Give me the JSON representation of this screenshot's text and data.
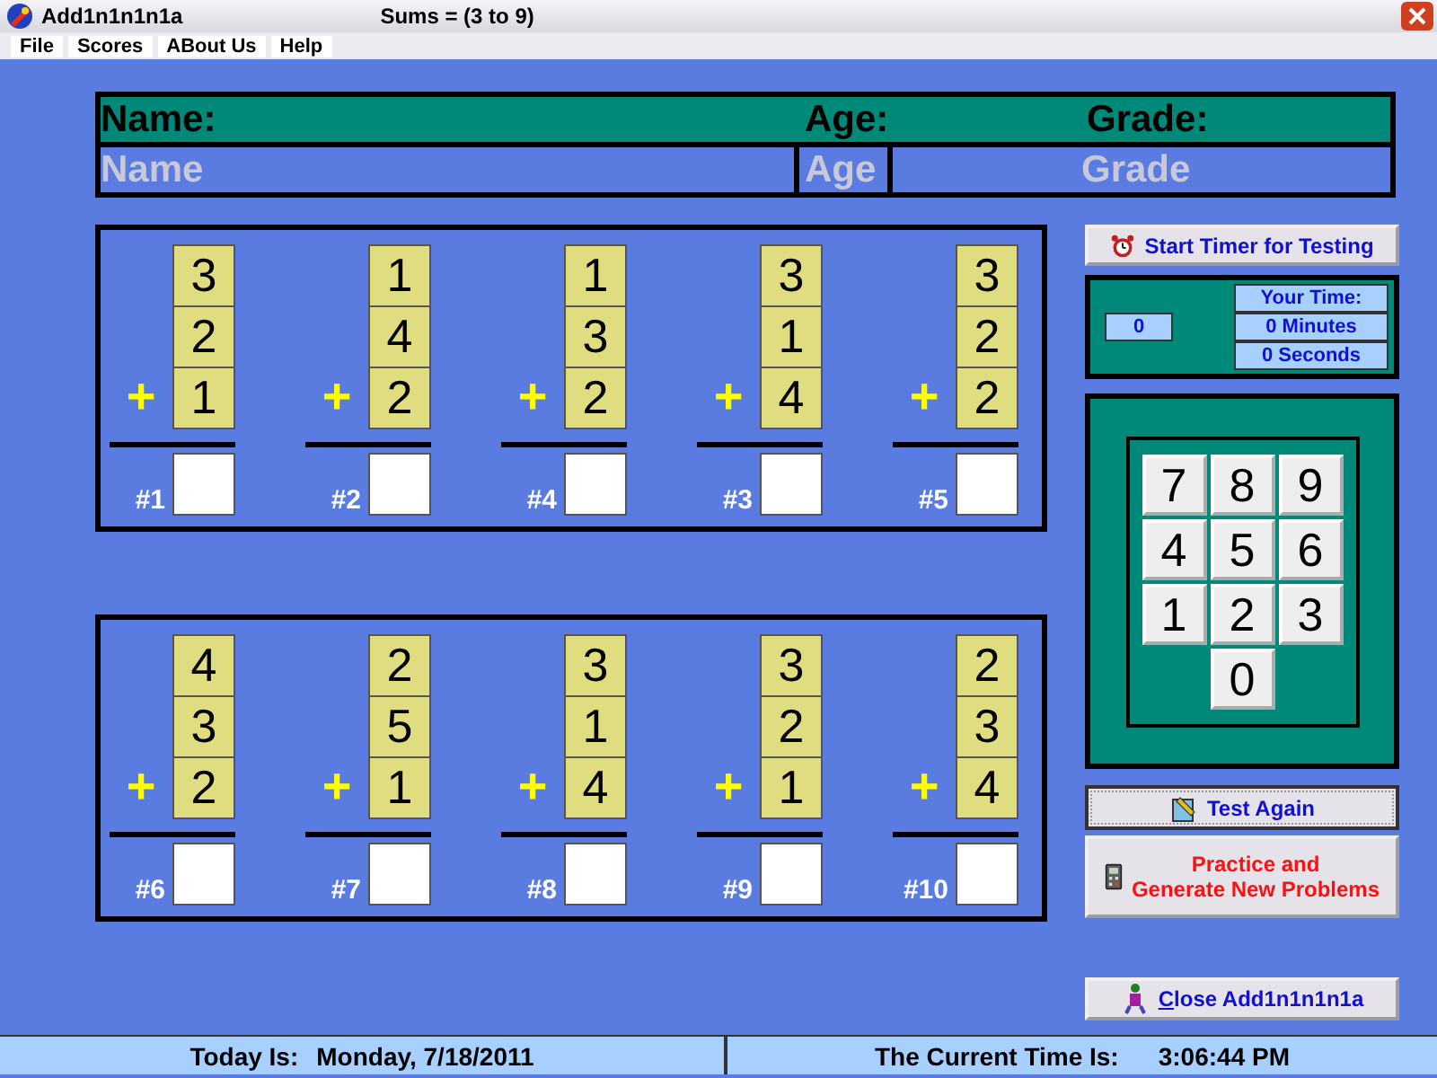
{
  "window": {
    "title": "Add1n1n1n1a",
    "subtitle": "Sums = (3 to 9)"
  },
  "menu": [
    "File",
    "Scores",
    "ABout Us",
    "Help"
  ],
  "student": {
    "labels": [
      "Name:",
      "Age:",
      "Grade:"
    ],
    "fields": [
      {
        "placeholder": "Name"
      },
      {
        "placeholder": "Age"
      },
      {
        "placeholder": "Grade"
      }
    ]
  },
  "problem_sets": [
    [
      {
        "label": "#1",
        "sign": "+",
        "addends": [
          "3",
          "2",
          "1"
        ]
      },
      {
        "label": "#2",
        "sign": "+",
        "addends": [
          "1",
          "4",
          "2"
        ]
      },
      {
        "label": "#4",
        "sign": "+",
        "addends": [
          "1",
          "3",
          "2"
        ]
      },
      {
        "label": "#3",
        "sign": "+",
        "addends": [
          "3",
          "1",
          "4"
        ]
      },
      {
        "label": "#5",
        "sign": "+",
        "addends": [
          "3",
          "2",
          "2"
        ]
      }
    ],
    [
      {
        "label": "#6",
        "sign": "+",
        "addends": [
          "4",
          "3",
          "2"
        ]
      },
      {
        "label": "#7",
        "sign": "+",
        "addends": [
          "2",
          "5",
          "1"
        ]
      },
      {
        "label": "#8",
        "sign": "+",
        "addends": [
          "3",
          "1",
          "4"
        ]
      },
      {
        "label": "#9",
        "sign": "+",
        "addends": [
          "3",
          "2",
          "1"
        ]
      },
      {
        "label": "#10",
        "sign": "+",
        "addends": [
          "2",
          "3",
          "4"
        ]
      }
    ]
  ],
  "timer_button": "Start Timer for Testing",
  "timer": {
    "count": "0",
    "heading": "Your Time:",
    "minutes": "0 Minutes",
    "seconds": "0 Seconds"
  },
  "keypad": [
    "7",
    "8",
    "9",
    "4",
    "5",
    "6",
    "1",
    "2",
    "3",
    "0"
  ],
  "buttons": [
    {
      "kind": "test",
      "lines": [
        "Test Again"
      ]
    },
    {
      "kind": "practice",
      "lines": [
        "Practice and",
        "Generate New Problems"
      ]
    },
    {
      "kind": "close",
      "lines": [
        "Close Add1n1n1n1a"
      ]
    }
  ],
  "status": {
    "date_label": "Today Is:",
    "date": "Monday, 7/18/2011",
    "time_label": "The Current Time Is:",
    "time": "3:06:44 PM"
  }
}
